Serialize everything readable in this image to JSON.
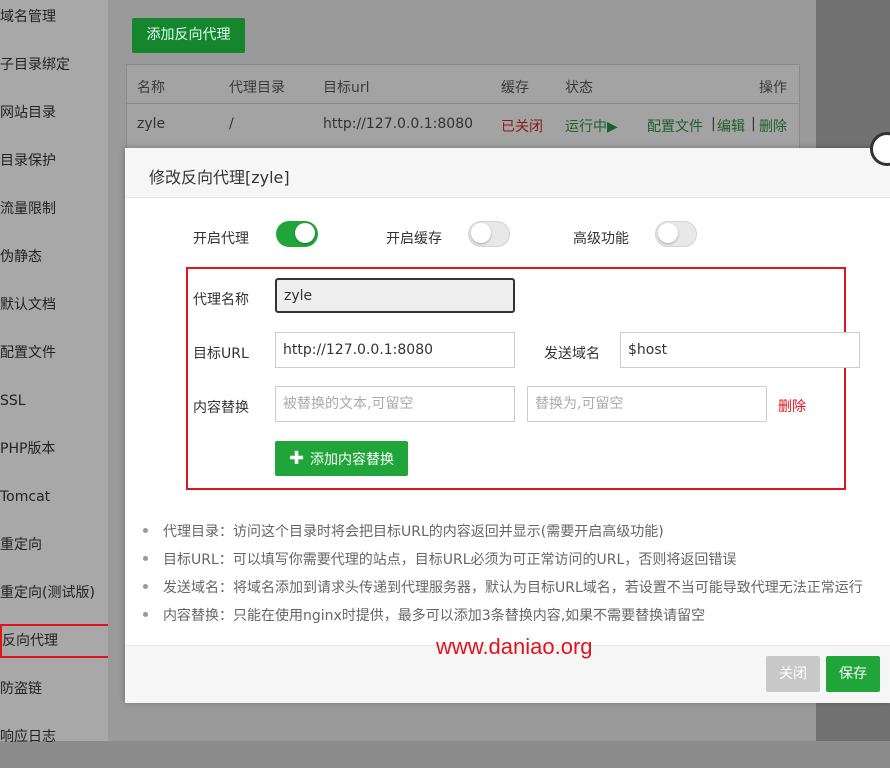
{
  "sidebar": {
    "items": [
      {
        "label": "域名管理"
      },
      {
        "label": "子目录绑定"
      },
      {
        "label": "网站目录"
      },
      {
        "label": "目录保护"
      },
      {
        "label": "流量限制"
      },
      {
        "label": "伪静态"
      },
      {
        "label": "默认文档"
      },
      {
        "label": "配置文件"
      },
      {
        "label": "SSL"
      },
      {
        "label": "PHP版本"
      },
      {
        "label": "Tomcat"
      },
      {
        "label": "重定向"
      },
      {
        "label": "重定向(测试版)"
      },
      {
        "label": "反向代理"
      },
      {
        "label": "防盗链"
      },
      {
        "label": "响应日志"
      }
    ],
    "active": "反向代理"
  },
  "background": {
    "add_button": "添加反向代理",
    "table": {
      "headers": [
        "名称",
        "代理目录",
        "目标url",
        "缓存",
        "状态",
        "操作"
      ],
      "row": {
        "name": "zyle",
        "dir": "/",
        "url": "http://127.0.0.1:8080",
        "cache": "已关闭",
        "status": "运行中▶",
        "op_config": "配置文件",
        "sep1": "|",
        "op_edit": "编辑",
        "sep2": "|",
        "op_delete": "删除"
      }
    }
  },
  "modal": {
    "title": "修改反向代理[zyle]",
    "toggles": [
      {
        "label": "开启代理",
        "on": true
      },
      {
        "label": "开启缓存",
        "on": false
      },
      {
        "label": "高级功能",
        "on": false
      }
    ],
    "fields": {
      "name_label": "代理名称",
      "name_value": "zyle",
      "url_label": "目标URL",
      "url_value": "http://127.0.0.1:8080",
      "domain_label": "发送域名",
      "domain_value": "$host",
      "replace_label": "内容替换",
      "replace_from_placeholder": "被替换的文本,可留空",
      "replace_to_placeholder": "替换为,可留空",
      "delete_label": "删除",
      "add_replace_button": "添加内容替换"
    },
    "help": [
      "代理目录：访问这个目录时将会把目标URL的内容返回并显示(需要开启高级功能)",
      "目标URL：可以填写你需要代理的站点，目标URL必须为可正常访问的URL，否则将返回错误",
      "发送域名：将域名添加到请求头传递到代理服务器，默认为目标URL域名，若设置不当可能导致代理无法正常运行",
      "内容替换：只能在使用nginx时提供，最多可以添加3条替换内容,如果不需要替换请留空"
    ],
    "buttons": {
      "close": "关闭",
      "save": "保存"
    }
  },
  "watermark": "www.daniao.org",
  "colors": {
    "accent": "#20a53a",
    "danger": "#e0141c"
  }
}
